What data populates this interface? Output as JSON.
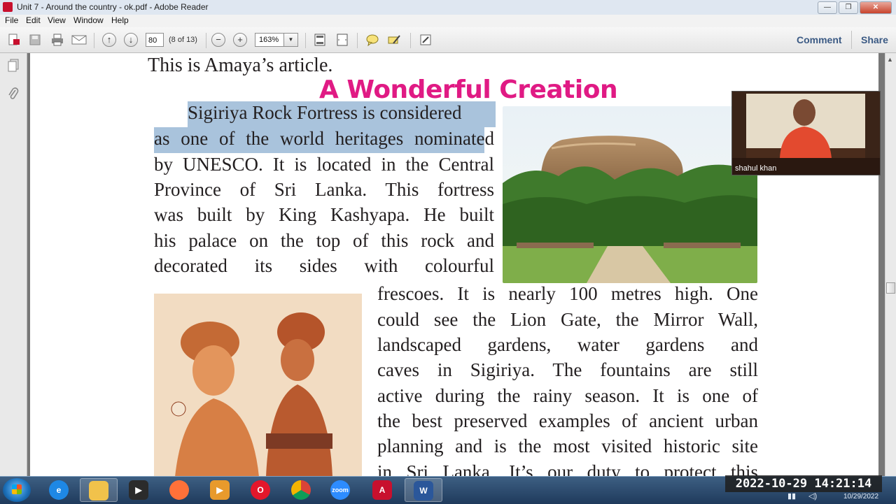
{
  "window": {
    "title": "Unit 7 - Around the country - ok.pdf - Adobe Reader",
    "min": "—",
    "restore": "❐",
    "close": "✕"
  },
  "menu": [
    "File",
    "Edit",
    "View",
    "Window",
    "Help"
  ],
  "toolbar": {
    "page_number": "80",
    "page_count": "(8 of 13)",
    "zoom": "163%",
    "comment": "Comment",
    "share": "Share"
  },
  "document": {
    "intro": "This is Amaya’s article.",
    "title": "A Wonderful Creation",
    "lines_top": [
      "Sigiriya Rock Fortress is considered",
      "as one of the world heritages nominated",
      "by UNESCO. It is located in the Central",
      "Province of Sri Lanka. This fortress",
      "was built by King Kashyapa. He built",
      "his palace on the top of this rock and",
      "decorated its sides with colourful"
    ],
    "lines_bottom": [
      "frescoes. It is nearly 100 metres high. One",
      "could see the Lion Gate, the Mirror Wall,",
      "landscaped gardens, water gardens and",
      "caves in Sigiriya. The fountains are still",
      "active during the rainy season. It is one of",
      "the best preserved examples of ancient urban",
      "planning and is the most visited historic site",
      "in Sri Lanka. It’s our duty to protect this"
    ]
  },
  "video": {
    "participant": "shahul khan"
  },
  "taskbar": {
    "datetime": "2022-10-29 14:21:14",
    "date": "10/29/2022",
    "zoom_label": "zoom"
  }
}
